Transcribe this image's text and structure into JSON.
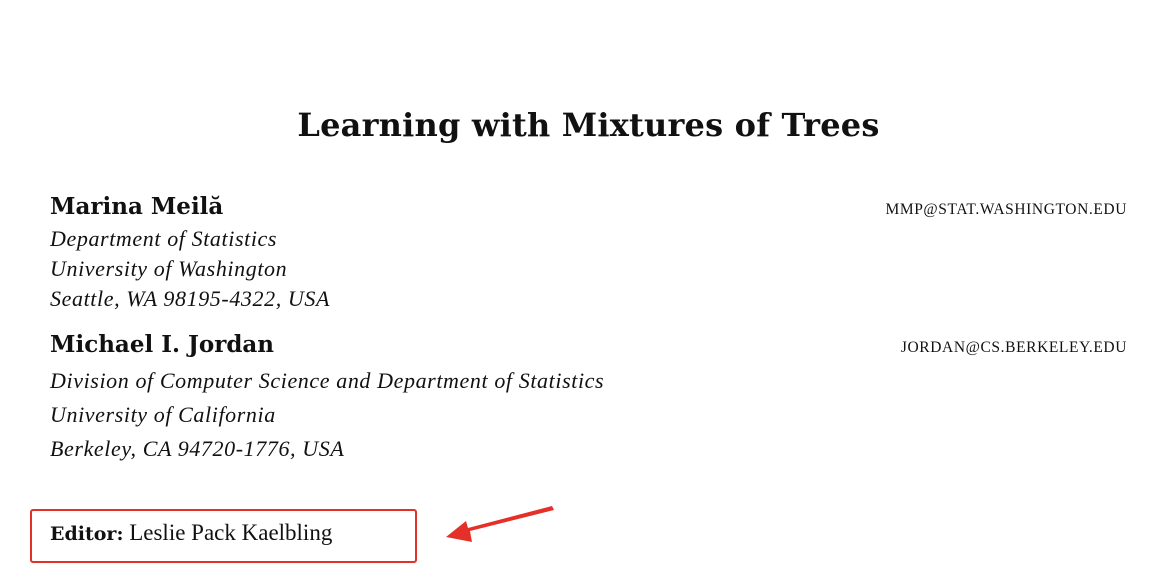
{
  "paper": {
    "title": "Learning with Mixtures of Trees",
    "authors": [
      {
        "name": "Marina Meilă",
        "email": "MMP@STAT.WASHINGTON.EDU",
        "affiliation": [
          "Department of Statistics",
          "University of Washington",
          "Seattle, WA 98195-4322, USA"
        ]
      },
      {
        "name": "Michael I. Jordan",
        "email": "JORDAN@CS.BERKELEY.EDU",
        "affiliation": [
          "Division of Computer Science and Department of Statistics",
          "University of California",
          "Berkeley, CA 94720-1776, USA"
        ]
      }
    ],
    "editor": {
      "label": "Editor:",
      "name": "Leslie Pack Kaelbling"
    }
  },
  "annotation": {
    "color": "#e5302a",
    "icon": "arrow-icon"
  }
}
